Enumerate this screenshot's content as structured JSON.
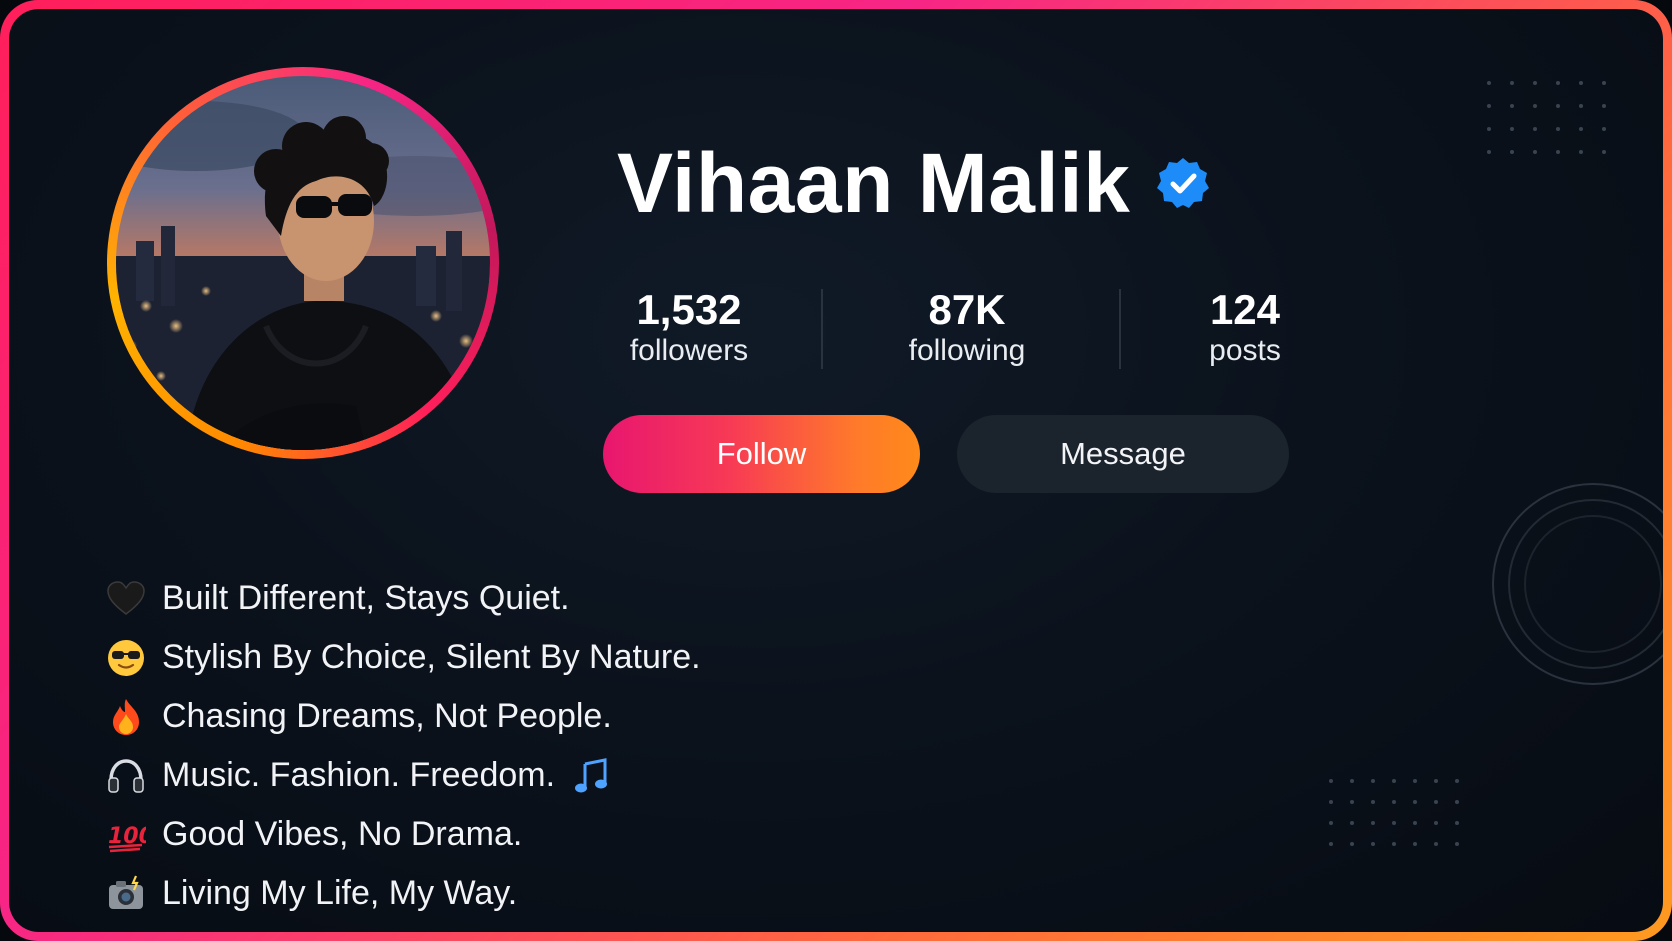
{
  "profile": {
    "name": "Vihaan Malik",
    "verified": true,
    "avatar_alt": "profile photo"
  },
  "stats": [
    {
      "value": "1,532",
      "label": "followers"
    },
    {
      "value": "87K",
      "label": "following"
    },
    {
      "value": "124",
      "label": "posts"
    }
  ],
  "actions": {
    "follow_label": "Follow",
    "message_label": "Message"
  },
  "bio": [
    {
      "icon": "black-heart-icon",
      "text": "Built Different, Stays Quiet."
    },
    {
      "icon": "sunglasses-face-icon",
      "text": "Stylish By Choice, Silent By Nature."
    },
    {
      "icon": "fire-icon",
      "text": "Chasing Dreams, Not People."
    },
    {
      "icon": "headphones-icon",
      "text": "Music. Fashion. Freedom.",
      "trailing_icon": "music-note-icon"
    },
    {
      "icon": "hundred-points-icon",
      "text": "Good Vibes, No Drama."
    },
    {
      "icon": "camera-flash-icon",
      "text": "Living My Life, My Way."
    }
  ],
  "colors": {
    "accent_start": "#e8166f",
    "accent_end": "#ff8a1a",
    "verified_blue": "#1d8cf8",
    "background": "#0b121c",
    "message_button": "#1b232d"
  }
}
